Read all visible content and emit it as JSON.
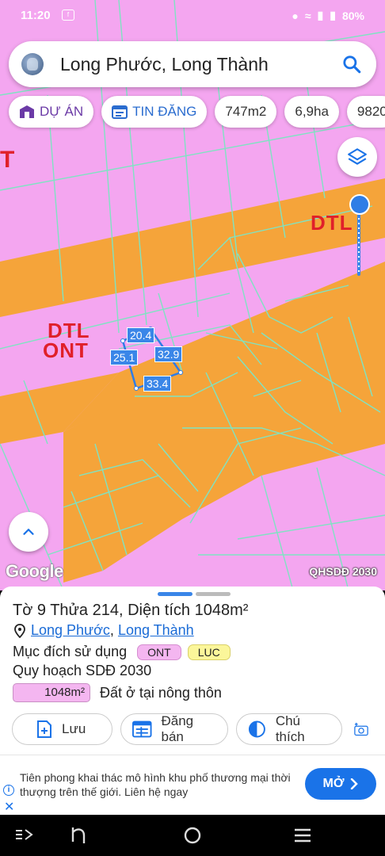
{
  "status_bar": {
    "time": "11:20",
    "battery": "80%"
  },
  "search": {
    "query": "Long Phước, Long Thành"
  },
  "chips": [
    {
      "label": "DỰ ÁN"
    },
    {
      "label": "TIN ĐĂNG"
    },
    {
      "label": "747m2"
    },
    {
      "label": "6,9ha"
    },
    {
      "label": "9820"
    }
  ],
  "map": {
    "zone_labels": {
      "dtl_right": "DTL",
      "dtl_left": "DTL",
      "ont_left": "ONT",
      "t_left": "T"
    },
    "edge_lengths": {
      "top": "20.4",
      "right": "32.9",
      "left": "25.1",
      "bottom": "33.4"
    },
    "watermark": "Google",
    "layer_name": "QHSDĐ 2030",
    "colors": {
      "land_residential": "#f4a6f0",
      "land_road": "#f5a43a",
      "parcel_lines": "#7fe3c2",
      "highlight": "#2f7de6"
    }
  },
  "parcel": {
    "title": "Tờ 9 Thửa 214, Diện tích 1048m²",
    "commune": "Long Phước",
    "separator": ", ",
    "district": "Long Thành",
    "purpose_label": "Mục đích sử dụng",
    "purpose_tags": [
      "ONT",
      "LUC"
    ],
    "plan_label": "Quy hoạch SDĐ 2030",
    "plan_area": "1048m²",
    "plan_desc": "Đất ở tại nông thôn"
  },
  "actions": {
    "save": "Lưu",
    "post": "Đăng bán",
    "legend": "Chú thích"
  },
  "ad": {
    "text": "Tiên phong khai thác mô hình khu phố thương mại thời thượng trên thế giới. Liên hệ ngay",
    "button": "MỞ"
  }
}
